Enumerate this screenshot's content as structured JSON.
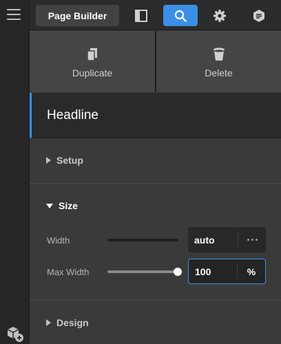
{
  "toolbar": {
    "app_button_label": "Page Builder",
    "icons": [
      "panel-layout-icon",
      "search-icon",
      "gear-icon",
      "notes-icon"
    ],
    "active_icon": "search-icon",
    "accent_color": "#3c8fe6"
  },
  "actions": [
    {
      "label": "Duplicate",
      "icon": "duplicate-icon"
    },
    {
      "label": "Delete",
      "icon": "trash-icon"
    }
  ],
  "element": {
    "title": "Headline"
  },
  "sections": {
    "setup": {
      "label": "Setup",
      "expanded": false
    },
    "size": {
      "label": "Size",
      "expanded": true,
      "width": {
        "label": "Width",
        "value": "auto"
      },
      "max_width": {
        "label": "Max Width",
        "value": "100",
        "unit": "%",
        "slider_fraction": 1.0
      }
    },
    "design": {
      "label": "Design",
      "expanded": false
    }
  },
  "rail": {
    "menu_icon": "hamburger-icon",
    "bottom_icon": "add-block-icon"
  }
}
